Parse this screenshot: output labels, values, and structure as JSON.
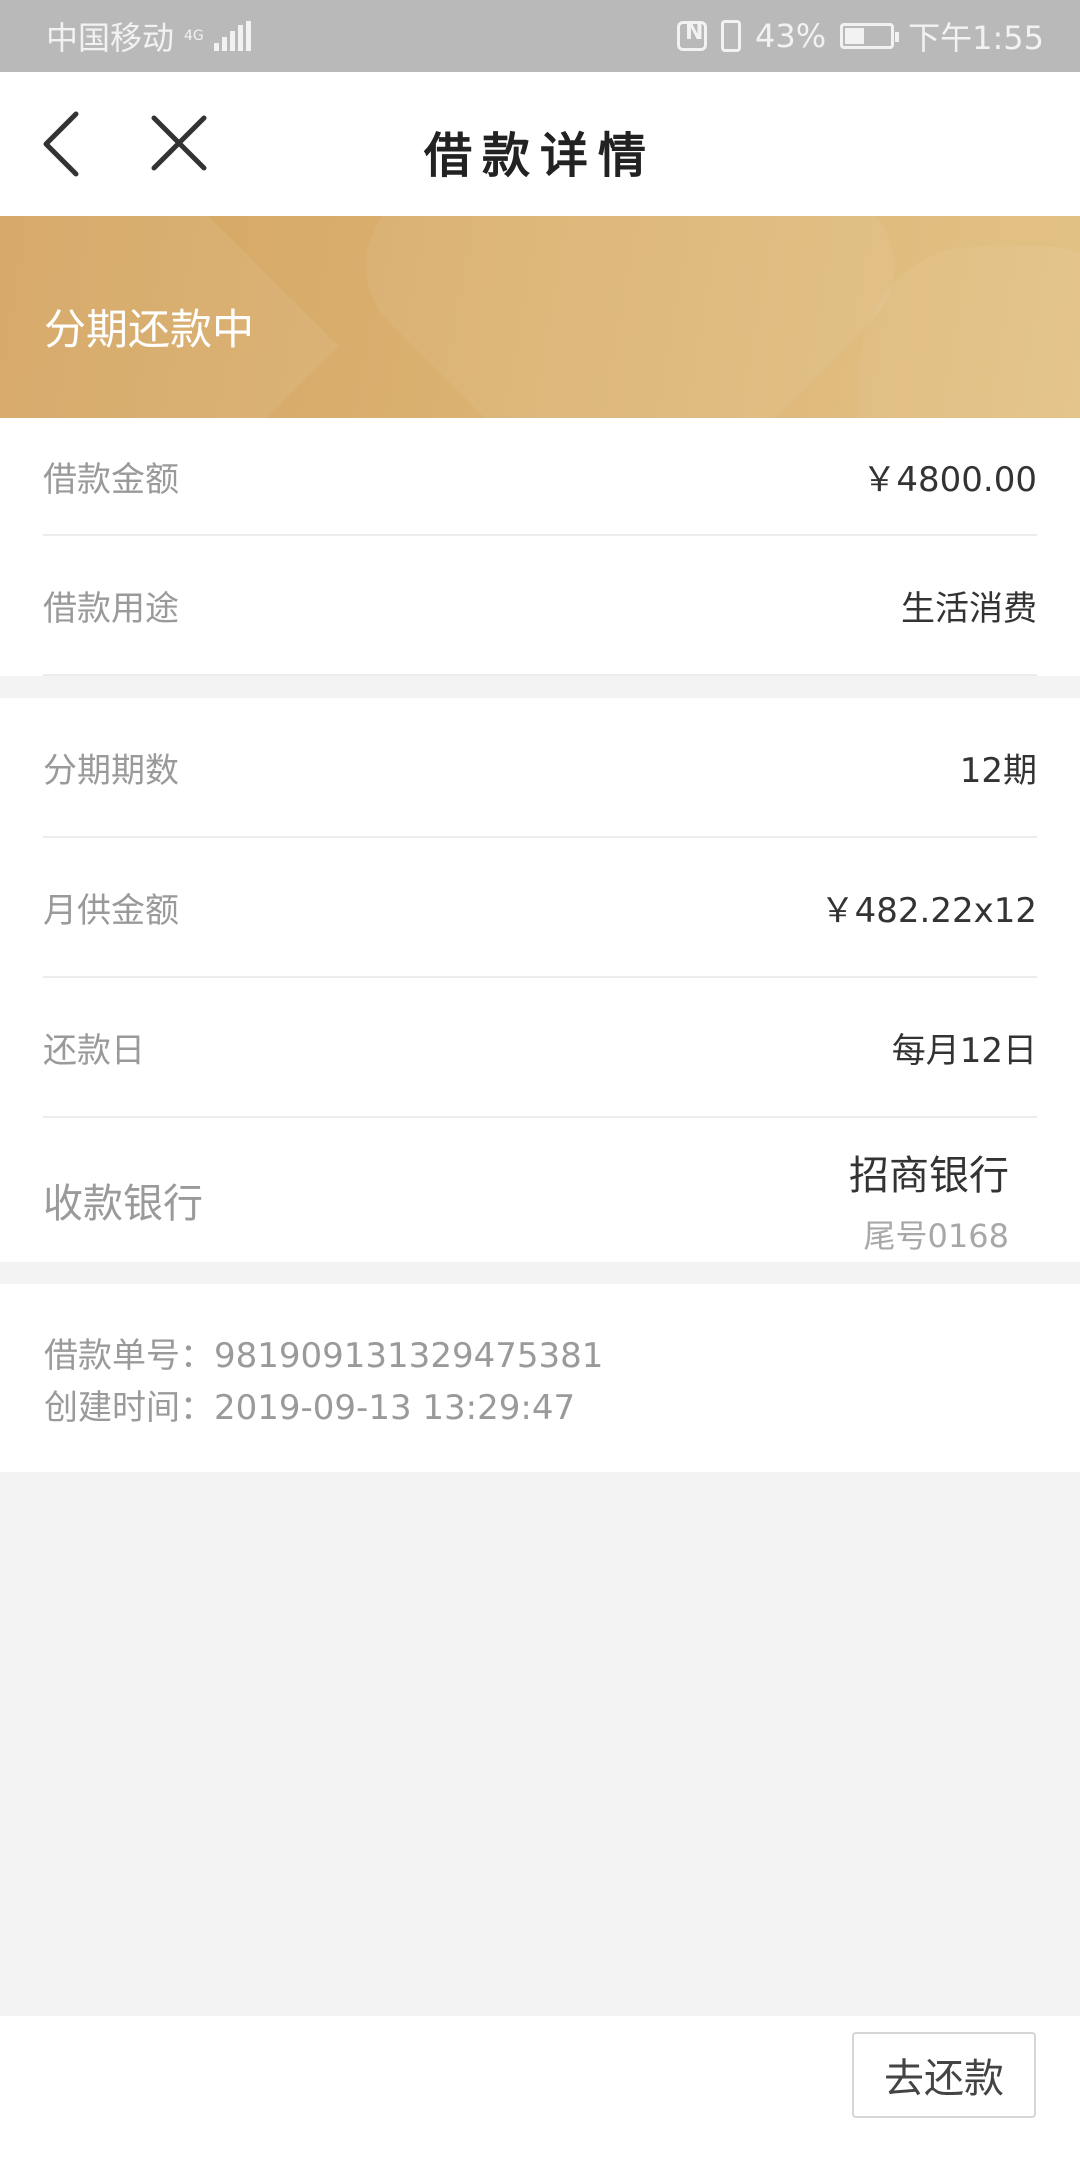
{
  "status_bar": {
    "carrier": "中国移动",
    "network": "4G",
    "battery_percent": "43%",
    "battery_level": 0.43,
    "time": "下午1:55"
  },
  "nav": {
    "title": "借款详情",
    "back_icon": "chevron-left-icon",
    "close_icon": "close-icon"
  },
  "banner": {
    "status": "分期还款中",
    "colors": {
      "start": "#d4a460",
      "end": "#e3c286"
    }
  },
  "details_group1": [
    {
      "label": "借款金额",
      "value": "￥4800.00"
    },
    {
      "label": "借款用途",
      "value": "生活消费"
    }
  ],
  "details_group2": [
    {
      "label": "分期期数",
      "value": "12期"
    },
    {
      "label": "月供金额",
      "value": "￥482.22x12"
    },
    {
      "label": "还款日",
      "value": "每月12日"
    }
  ],
  "bank": {
    "label": "收款银行",
    "name": "招商银行",
    "tail": "尾号0168"
  },
  "order": {
    "number_label": "借款单号：",
    "number": "981909131329475381",
    "created_label": "创建时间：",
    "created": "2019-09-13 13:29:47"
  },
  "actions": {
    "repay_label": "去还款"
  }
}
